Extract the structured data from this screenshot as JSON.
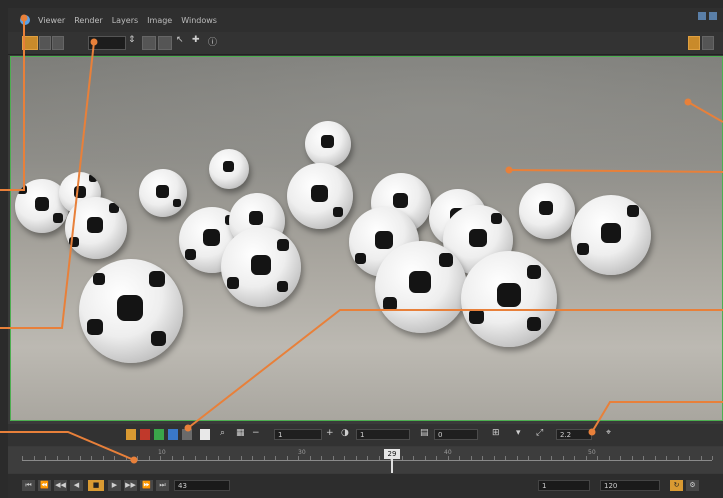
{
  "menu": {
    "items": [
      "Viewer",
      "Render",
      "Layers",
      "Image",
      "Windows"
    ]
  },
  "viewer": {
    "overlay_left": "",
    "overlay_right_lines": [
      "",
      ""
    ]
  },
  "viewer_toolbar": {
    "gain_value": "1",
    "gamma_value": "1",
    "proxy_value": "0",
    "zoom_value": "2.2"
  },
  "timeline": {
    "ticks": [
      "10",
      "20",
      "30",
      "40",
      "50"
    ],
    "current_frame": "29"
  },
  "transport": {
    "frame_field": "43",
    "start_field": "1",
    "end_field": "120"
  },
  "colors": {
    "accent": "#e8803a",
    "active_button": "#c98a2a",
    "overlay_green": "#6ee06e"
  },
  "icons": [
    "app-logo-icon",
    "play-icon",
    "stop-icon",
    "rewind-icon",
    "fast-forward-icon",
    "step-back-icon",
    "step-forward-icon",
    "zoom-icon",
    "color-swatch-icon"
  ]
}
